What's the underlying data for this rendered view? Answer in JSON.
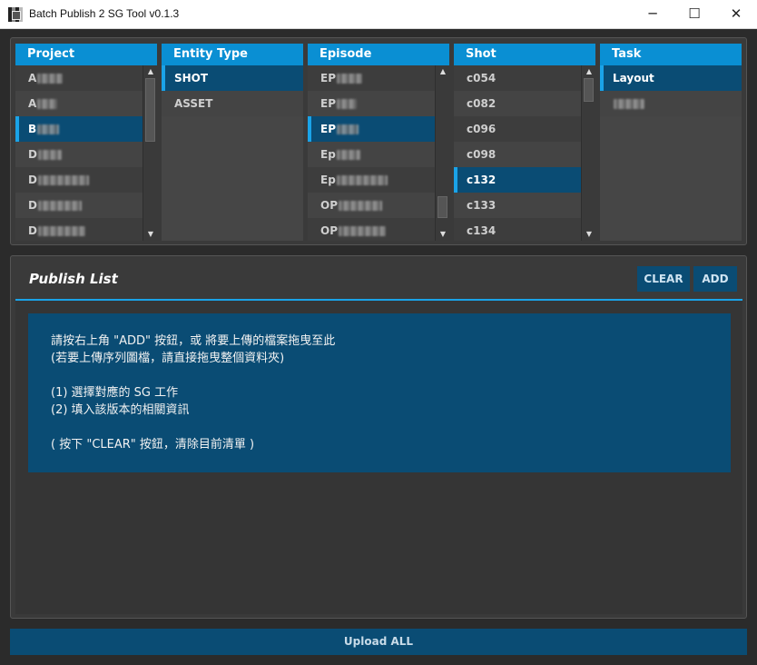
{
  "window": {
    "title": "Batch Publish 2 SG Tool v0.1.3",
    "minimize": "─",
    "maximize": "☐",
    "close": "✕"
  },
  "columns": {
    "project": {
      "header": "Project",
      "items": [
        "A",
        "A",
        "B",
        "D",
        "D",
        "D",
        "D"
      ],
      "selected_index": 2
    },
    "entity_type": {
      "header": "Entity Type",
      "items": [
        "SHOT",
        "ASSET"
      ],
      "selected_index": 0
    },
    "episode": {
      "header": "Episode",
      "items": [
        "EP",
        "EP",
        "EP",
        "Ep",
        "Ep",
        "OP",
        "OP"
      ],
      "selected_index": 2
    },
    "shot": {
      "header": "Shot",
      "items": [
        "c054",
        "c082",
        "c096",
        "c098",
        "c132",
        "c133",
        "c134"
      ],
      "selected_index": 4
    },
    "task": {
      "header": "Task",
      "items": [
        "Layout",
        ""
      ],
      "selected_index": 0
    }
  },
  "publish": {
    "title": "Publish List",
    "clear_label": "CLEAR",
    "add_label": "ADD",
    "instructions": [
      "請按右上角 \"ADD\" 按鈕，或 將要上傳的檔案拖曳至此",
      "(若要上傳序列圖檔，請直接拖曳整個資料夾)",
      "",
      "(1) 選擇對應的 SG 工作",
      "(2) 填入該版本的相關資訊",
      "",
      "( 按下 \"CLEAR\" 按鈕，清除目前清單 )"
    ]
  },
  "upload_label": "Upload ALL",
  "colors": {
    "header_blue": "#0a8fd3",
    "selected_blue": "#0a4c74",
    "accent": "#1aa3e8"
  }
}
